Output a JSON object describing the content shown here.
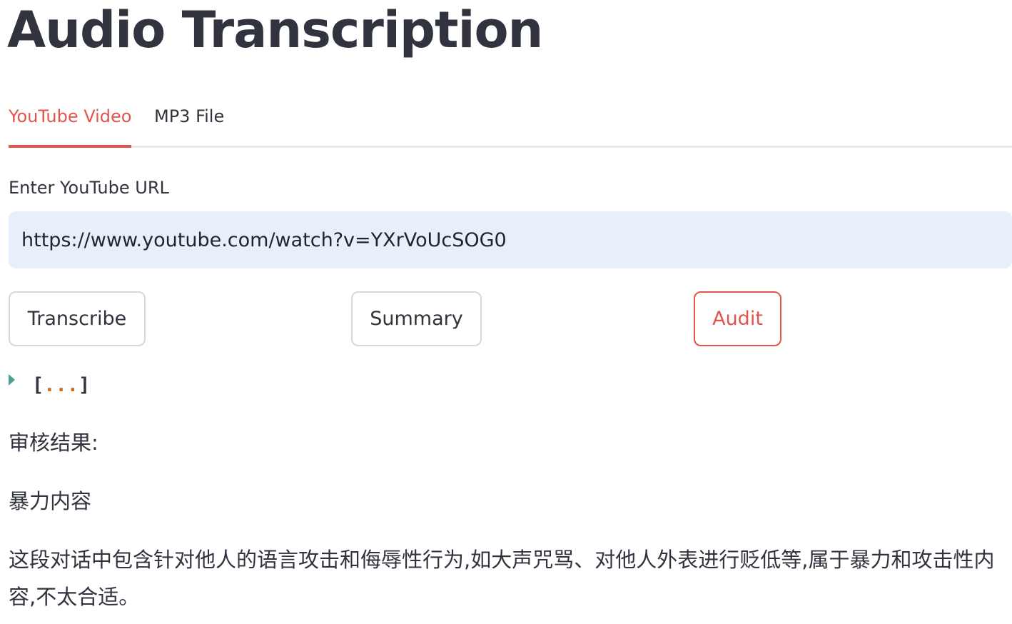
{
  "title": "Audio Transcription",
  "tabs": [
    {
      "label": "YouTube Video",
      "active": true
    },
    {
      "label": "MP3 File",
      "active": false
    }
  ],
  "url_field": {
    "label": "Enter YouTube URL",
    "value": "https://www.youtube.com/watch?v=YXrVoUcSOG0"
  },
  "buttons": {
    "transcribe": "Transcribe",
    "summary": "Summary",
    "audit": "Audit"
  },
  "json_viewer": {
    "open_bracket": "[",
    "ellipsis": "...",
    "close_bracket": "]"
  },
  "result": {
    "label": "审核结果:",
    "category": "暴力内容",
    "detail": "这段对话中包含针对他人的语言攻击和侮辱性行为,如大声咒骂、对他人外表进行贬低等,属于暴力和攻击性内容,不太合适。"
  },
  "colors": {
    "accent": "#e2544c",
    "text": "#31333f",
    "input_bg": "#e8effb",
    "caret": "#4d9f97",
    "json_dots": "#d2691e"
  }
}
